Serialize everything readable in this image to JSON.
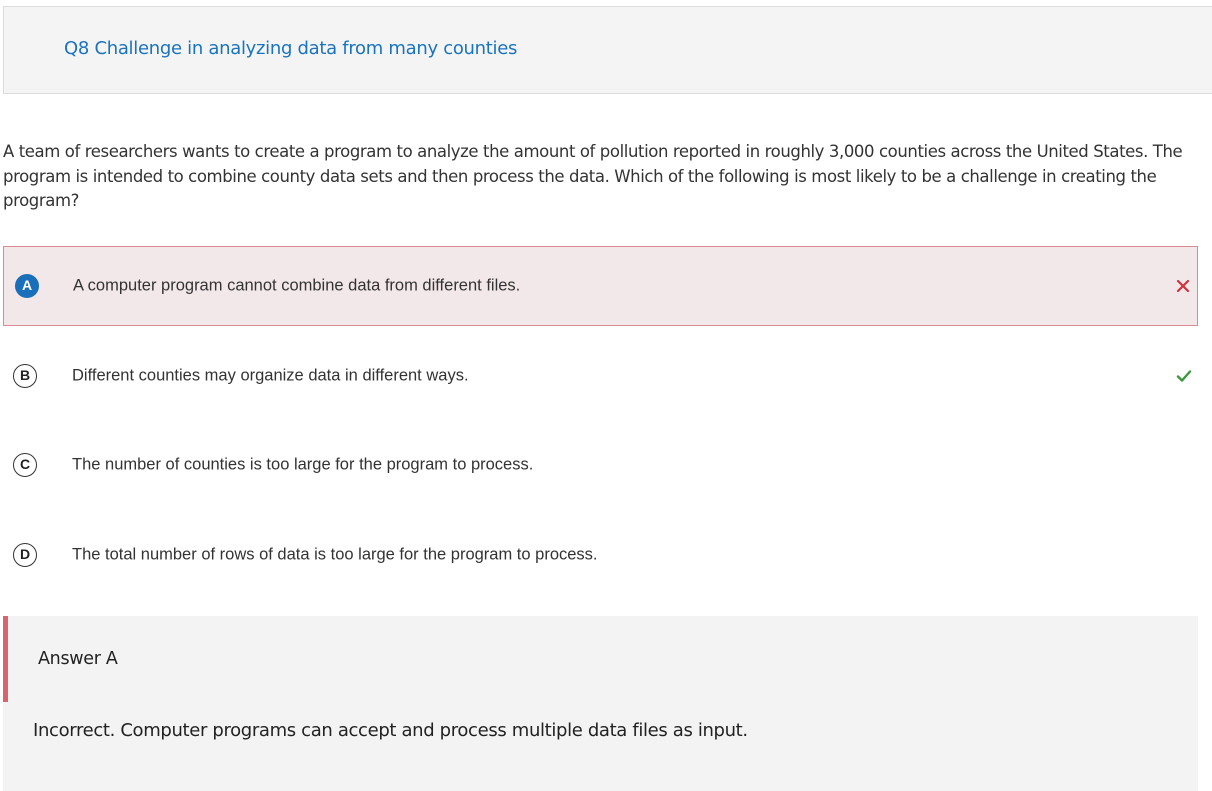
{
  "header": {
    "title": "Q8 Challenge in analyzing data from many counties"
  },
  "question": {
    "text": "A team of researchers wants to create a program to analyze the amount of pollution reported in roughly 3,000 counties across the United States. The program is intended to combine county data sets and then process the data. Which of the following is most likely to be a challenge in creating the program?"
  },
  "options": [
    {
      "letter": "A",
      "text": "A computer program cannot combine data from different files.",
      "state": "selected-incorrect",
      "mark_icon": "x-icon",
      "mark_color": "#d1313d"
    },
    {
      "letter": "B",
      "text": "Different counties may organize data in different ways.",
      "state": "correct",
      "mark_icon": "check-icon",
      "mark_color": "#3a9a3a"
    },
    {
      "letter": "C",
      "text": "The number of counties is too large for the program to process.",
      "state": "none"
    },
    {
      "letter": "D",
      "text": "The total number of rows of data is too large for the program to process.",
      "state": "none"
    }
  ],
  "feedback": {
    "title": "Answer A",
    "text": "Incorrect. Computer programs can accept and process multiple data files as input."
  },
  "colors": {
    "accent": "#1a73c0",
    "incorrect_border": "#d98a93",
    "incorrect_bg": "#f3e8e9",
    "feedback_bar": "#d9636f",
    "selected_letter_bg": "#1a6fba"
  }
}
